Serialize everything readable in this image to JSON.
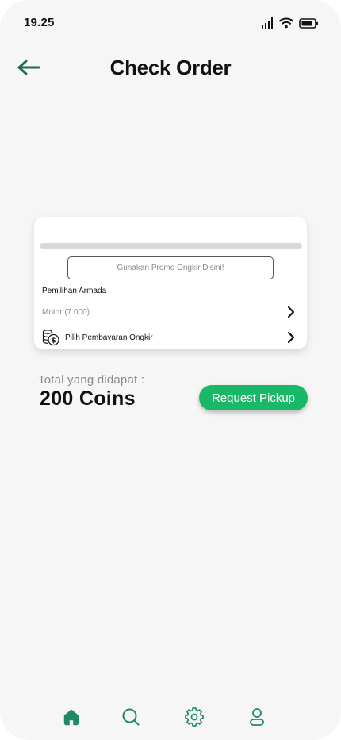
{
  "status_bar": {
    "time": "19.25",
    "icons": [
      "signal-icon",
      "wifi-icon",
      "battery-icon"
    ]
  },
  "header": {
    "back_icon": "arrow-left-icon",
    "title": "Check Order"
  },
  "order_card": {
    "promo_button_label": "Gunakan Promo Ongkir Disini!",
    "armada_title": "Pemilihan Armada",
    "armada_value": "Motor (7.000)",
    "payment_icon": "coins-dollar-icon",
    "payment_label": "Pilih Pembayaran Ongkir"
  },
  "total": {
    "label": "Total yang didapat :",
    "value": "200 Coins"
  },
  "actions": {
    "request_pickup_label": "Request Pickup"
  },
  "bottom_nav": {
    "items": [
      {
        "icon": "home-icon",
        "active": true
      },
      {
        "icon": "search-icon",
        "active": false
      },
      {
        "icon": "gear-icon",
        "active": false
      },
      {
        "icon": "user-icon",
        "active": false
      }
    ]
  },
  "colors": {
    "accent": "#19b866",
    "nav_icon": "#1f8a62",
    "back_arrow": "#1f6e4e",
    "background": "#f6f6f6",
    "text_muted": "#8a8a8a"
  }
}
